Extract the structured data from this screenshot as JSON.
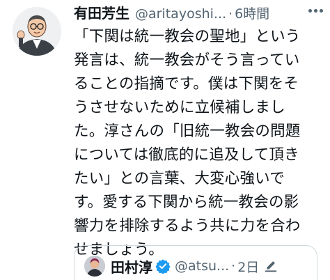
{
  "tweet": {
    "author_name": "有田芳生",
    "author_handle": "@aritayoshi...",
    "separator": "·",
    "time": "6時間",
    "body_lines": [
      "「下関は統一教会の聖地」という",
      "発言は、統一教会がそう言ってい",
      "ることの指摘です。僕は下関をそ",
      "うさせないために立候補しまし",
      "た。淳さんの「旧統一教会の問題",
      "については徹底的に追及して頂き",
      "たい」との言葉、大変心強いで",
      "す。愛する下関から統一教会の影",
      "響力を排除するよう共に力を合わ",
      "せましょう。"
    ]
  },
  "quoted": {
    "author_name": "田村淳",
    "author_handle": "@atsu...",
    "separator": "·",
    "time": "2日",
    "verified_color": "#1d9bf0"
  },
  "icons": {
    "more": "more-horizontal-icon",
    "verified": "verified-badge-icon",
    "edit": "pencil-edit-icon"
  }
}
